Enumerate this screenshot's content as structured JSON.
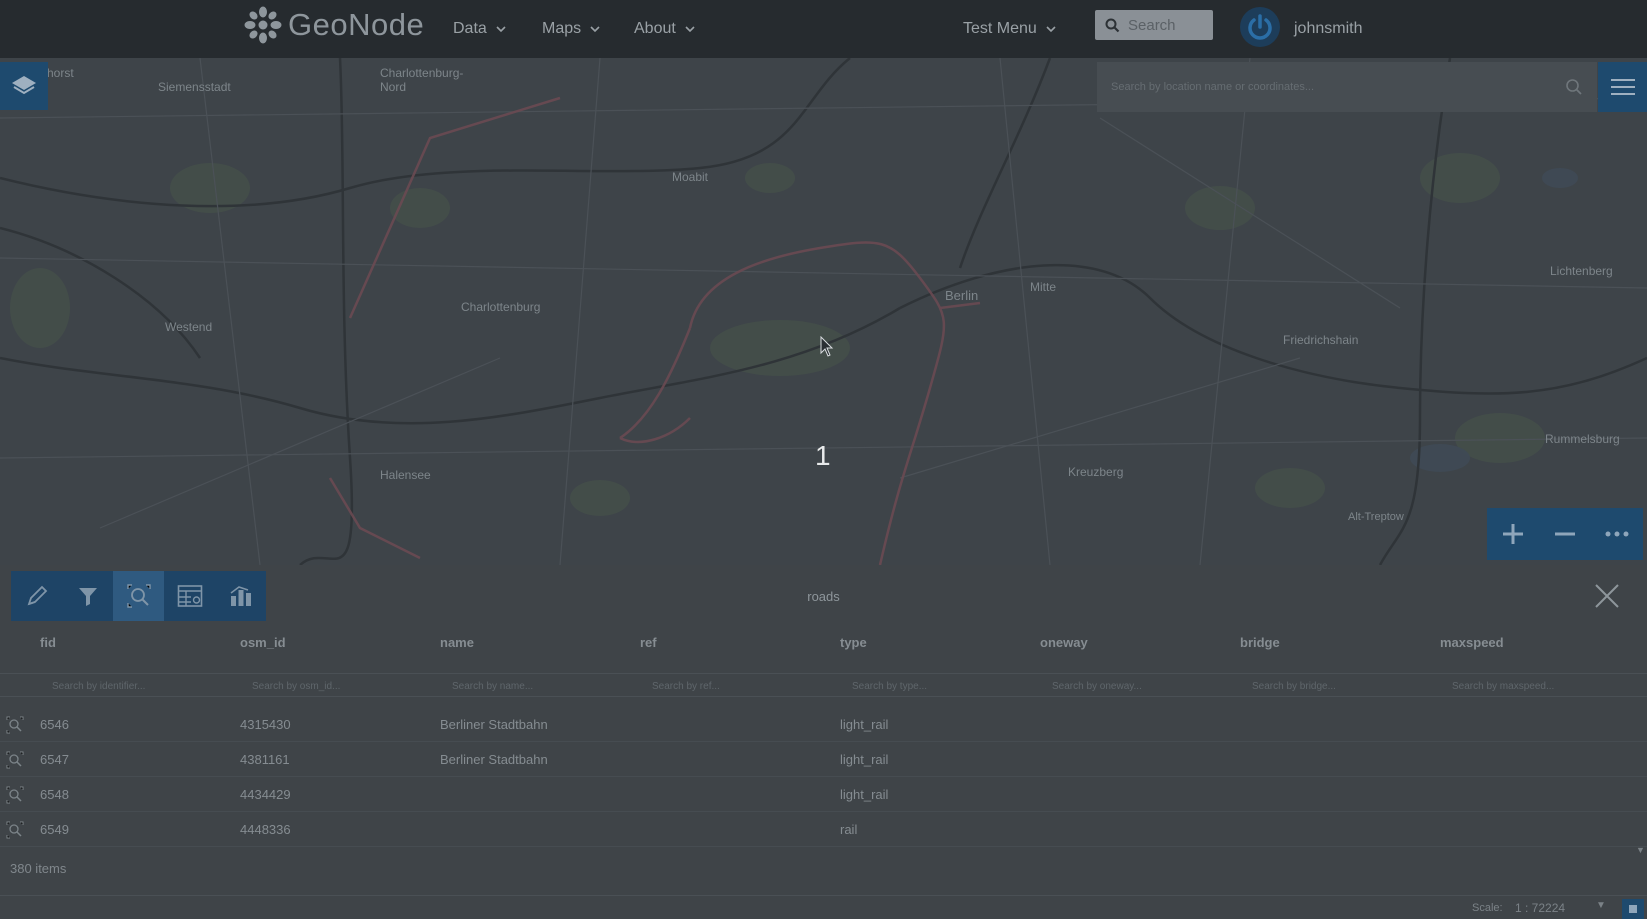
{
  "header": {
    "brand": "GeoNode",
    "nav": [
      {
        "label": "Data"
      },
      {
        "label": "Maps"
      },
      {
        "label": "About"
      },
      {
        "label": "Test Menu"
      }
    ],
    "search_placeholder": "Search",
    "username": "johnsmith"
  },
  "map": {
    "labels": [
      "horst",
      "Siemensstadt",
      "Charlottenburg-Nord",
      "Moabit",
      "Charlottenburg",
      "Berlin",
      "Mitte",
      "Friedrichshain",
      "Lichtenberg",
      "Westend",
      "Kreuzberg",
      "Rummelsburg",
      "Alt-Treptow",
      "Halensee"
    ],
    "search_placeholder": "Search by location name or coordinates...",
    "step_marker": "1"
  },
  "grid": {
    "title": "roads",
    "columns": [
      "fid",
      "osm_id",
      "name",
      "ref",
      "type",
      "oneway",
      "bridge",
      "maxspeed"
    ],
    "filter_placeholders": [
      "Search by identifier...",
      "Search by osm_id...",
      "Search by name...",
      "Search by ref...",
      "Search by type...",
      "Search by oneway...",
      "Search by bridge...",
      "Search by maxspeed..."
    ],
    "rows": [
      {
        "fid": "6546",
        "osm_id": "4315430",
        "name": "Berliner Stadtbahn",
        "type": "light_rail"
      },
      {
        "fid": "6547",
        "osm_id": "4381161",
        "name": "Berliner Stadtbahn",
        "type": "light_rail"
      },
      {
        "fid": "6548",
        "osm_id": "4434429",
        "name": "",
        "type": "light_rail"
      },
      {
        "fid": "6549",
        "osm_id": "4448336",
        "name": "",
        "type": "rail"
      }
    ],
    "item_count": "380 items",
    "scale_label": "Scale:",
    "scale_value": "1 : 72224"
  },
  "colors": {
    "header_bg": "#262b2f",
    "accent": "#1e4a6e"
  },
  "icons": [
    "geonode-logo-icon",
    "chevron-down-icon",
    "search-icon",
    "power-icon",
    "layers-icon",
    "menu-icon",
    "zoom-in-icon",
    "zoom-out-icon",
    "more-icon",
    "edit-icon",
    "filter-icon",
    "zoom-to-feature-icon",
    "table-settings-icon",
    "chart-icon",
    "close-icon"
  ]
}
